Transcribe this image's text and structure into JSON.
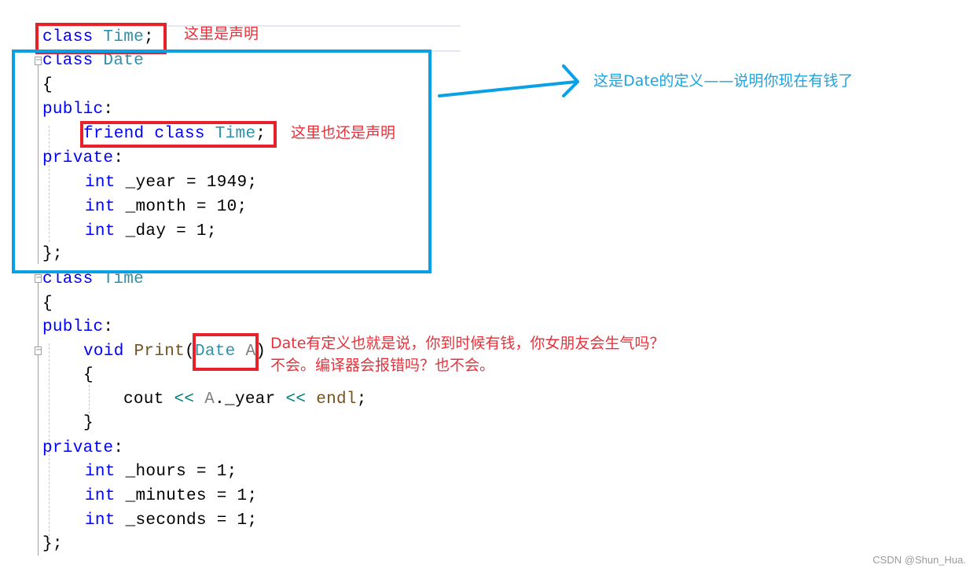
{
  "code": {
    "line_decl": {
      "kw": "class",
      "name": "Time",
      "end": ";"
    },
    "date_class": {
      "kw": "class",
      "name": "Date",
      "open": "{",
      "public": "public",
      "colon": ":",
      "friend": {
        "kw1": "friend",
        "kw2": "class",
        "name": "Time",
        "end": ";"
      },
      "private": "private",
      "members": [
        {
          "type": "int",
          "rest": " _year = 1949;"
        },
        {
          "type": "int",
          "rest": " _month = 10;"
        },
        {
          "type": "int",
          "rest": " _day = 1;"
        }
      ],
      "close": "};"
    },
    "time_class": {
      "kw": "class",
      "name": "Time",
      "open": "{",
      "public": "public",
      "colon": ":",
      "method": {
        "ret": "void",
        "name": "Print",
        "lparen": "(",
        "ptype": "Date",
        "pname": "A",
        "rparen": ")"
      },
      "body_open": "{",
      "stmt": {
        "cout": "cout",
        "op1": "<<",
        "obj": "A",
        "member": "._year",
        "op2": "<<",
        "endl": "endl",
        "end": ";"
      },
      "body_close": "}",
      "private": "private",
      "members": [
        {
          "type": "int",
          "rest": " _hours = 1;"
        },
        {
          "type": "int",
          "rest": " _minutes = 1;"
        },
        {
          "type": "int",
          "rest": " _seconds = 1;"
        }
      ],
      "close": "};"
    }
  },
  "annotations": {
    "declaration": "这里是声明",
    "friend_declaration": "这里也还是声明",
    "definition": "这是Date的定义——说明你现在有钱了",
    "usage_line1": "Date有定义也就是说，你到时候有钱，你女朋友会生气吗？",
    "usage_line2": "不会。编译器会报错吗？也不会。"
  },
  "colors": {
    "highlight_red": "#e8202a",
    "highlight_blue": "#0aa0e6",
    "keyword": "#0000ff",
    "type": "#2b91af"
  },
  "watermark": "CSDN @Shun_Hua."
}
